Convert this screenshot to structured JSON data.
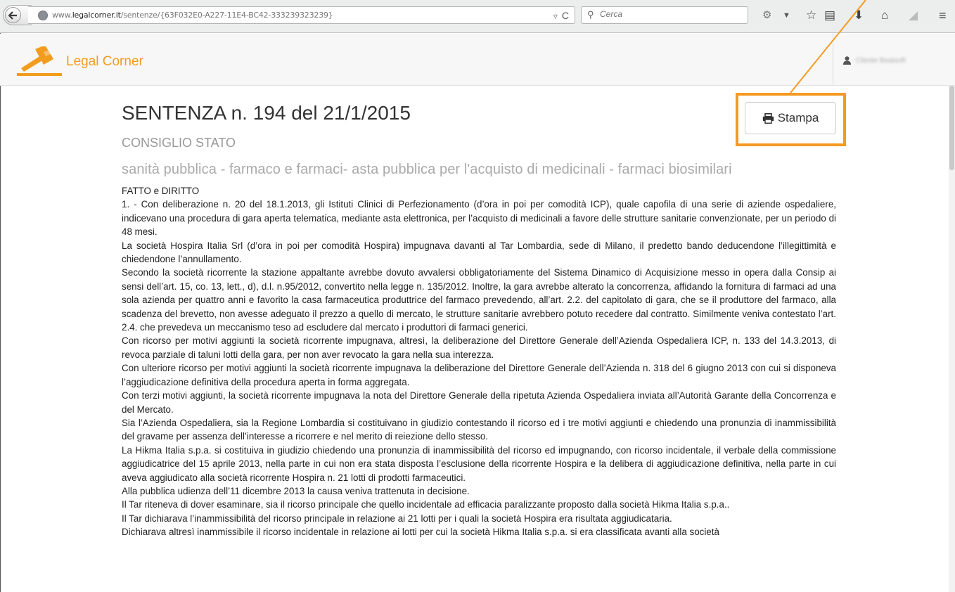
{
  "browser": {
    "url_prefix": "www.",
    "url_domain": "legalcorner.it",
    "url_path": "/sentenze/{63F032E0-A227-11E4-BC42-333239323239}",
    "search_placeholder": "Cerca"
  },
  "site": {
    "brand": "Legal Corner",
    "user_name": "Cliente Beatsoft"
  },
  "document": {
    "title": "SENTENZA n. 194 del 21/1/2015",
    "court": "CONSIGLIO STATO",
    "subject": "sanità pubblica - farmaco e farmaci- asta pubblica per l'acquisto di medicinali - farmaci biosimilari",
    "print_label": "Stampa",
    "paragraphs": [
      "FATTO e DIRITTO",
      "1. - Con deliberazione n. 20 del 18.1.2013, gli Istituti Clinici di Perfezionamento (d’ora in poi per comodità ICP), quale capofila di una serie di aziende ospedaliere, indicevano una procedura di gara aperta telematica, mediante asta elettronica, per l’acquisto di medicinali a favore delle strutture sanitarie convenzionate, per un periodo di 48 mesi.",
      "La società Hospira Italia Srl (d’ora in poi per comodità Hospira) impugnava davanti al Tar Lombardia, sede di Milano, il predetto bando deducendone l’illegittimità e chiedendone l’annullamento.",
      "Secondo la società ricorrente la stazione appaltante avrebbe dovuto avvalersi obbligatoriamente del Sistema Dinamico di Acquisizione messo in opera dalla Consip ai sensi dell’art. 15, co. 13, lett., d), d.l. n.95/2012, convertito nella legge n. 135/2012. Inoltre, la gara avrebbe alterato la concorrenza, affidando la fornitura di farmaci ad una sola azienda per quattro anni e favorito la casa farmaceutica produttrice del farmaco prevedendo, all’art. 2.2. del capitolato di gara, che se il produttore del farmaco, alla scadenza del brevetto, non avesse adeguato il prezzo a quello di mercato, le strutture sanitarie avrebbero potuto recedere dal contratto. Similmente veniva contestato l’art. 2.4. che prevedeva un meccanismo teso ad escludere dal mercato i produttori di farmaci generici.",
      "Con ricorso per motivi aggiunti la società ricorrente impugnava, altresì, la deliberazione del Direttore Generale dell’Azienda Ospedaliera ICP, n. 133 del 14.3.2013, di revoca parziale di taluni lotti della gara, per non aver revocato la gara nella sua interezza.",
      "Con ulteriore ricorso per motivi aggiunti la società ricorrente impugnava la deliberazione del Direttore Generale dell’Azienda n. 318 del 6 giugno 2013 con cui si disponeva l’aggiudicazione definitiva della procedura aperta in forma aggregata.",
      "Con terzi motivi aggiunti, la società ricorrente impugnava la nota del Direttore Generale della ripetuta Azienda Ospedaliera inviata all’Autorità Garante della Concorrenza e del Mercato.",
      "Sia l’Azienda Ospedaliera, sia la Regione Lombardia si costituivano in giudizio contestando il ricorso ed i tre motivi aggiunti e chiedendo una pronunzia di inammissibilità del gravame per assenza dell’interesse a ricorrere e nel merito di reiezione dello stesso.",
      "La Hikma Italia s.p.a. si costituiva in giudizio chiedendo una pronunzia di inammissibilità del ricorso ed impugnando, con ricorso incidentale, il verbale della commissione aggiudicatrice del 15 aprile 2013, nella parte in cui non era stata disposta l’esclusione della ricorrente Hospira e la delibera di aggiudicazione definitiva, nella parte in cui aveva aggiudicato alla società ricorrente Hospira n. 21 lotti di prodotti farmaceutici.",
      "Alla pubblica udienza dell’11 dicembre 2013 la causa veniva trattenuta in decisione.",
      "Il Tar riteneva di dover esaminare, sia il ricorso principale che quello incidentale ad efficacia paralizzante proposto dalla società Hikma Italia s.p.a..",
      "Il Tar dichiarava l’inammissibilità del ricorso principale in relazione ai 21 lotti per i quali la società Hospira era risultata aggiudicataria.",
      "Dichiarava altresì inammissibile il ricorso incidentale in relazione ai lotti per cui la società Hikma Italia s.p.a. si era classificata avanti alla società"
    ]
  },
  "colors": {
    "brand_orange": "#f29c1f",
    "highlight_orange": "#f59a23"
  }
}
